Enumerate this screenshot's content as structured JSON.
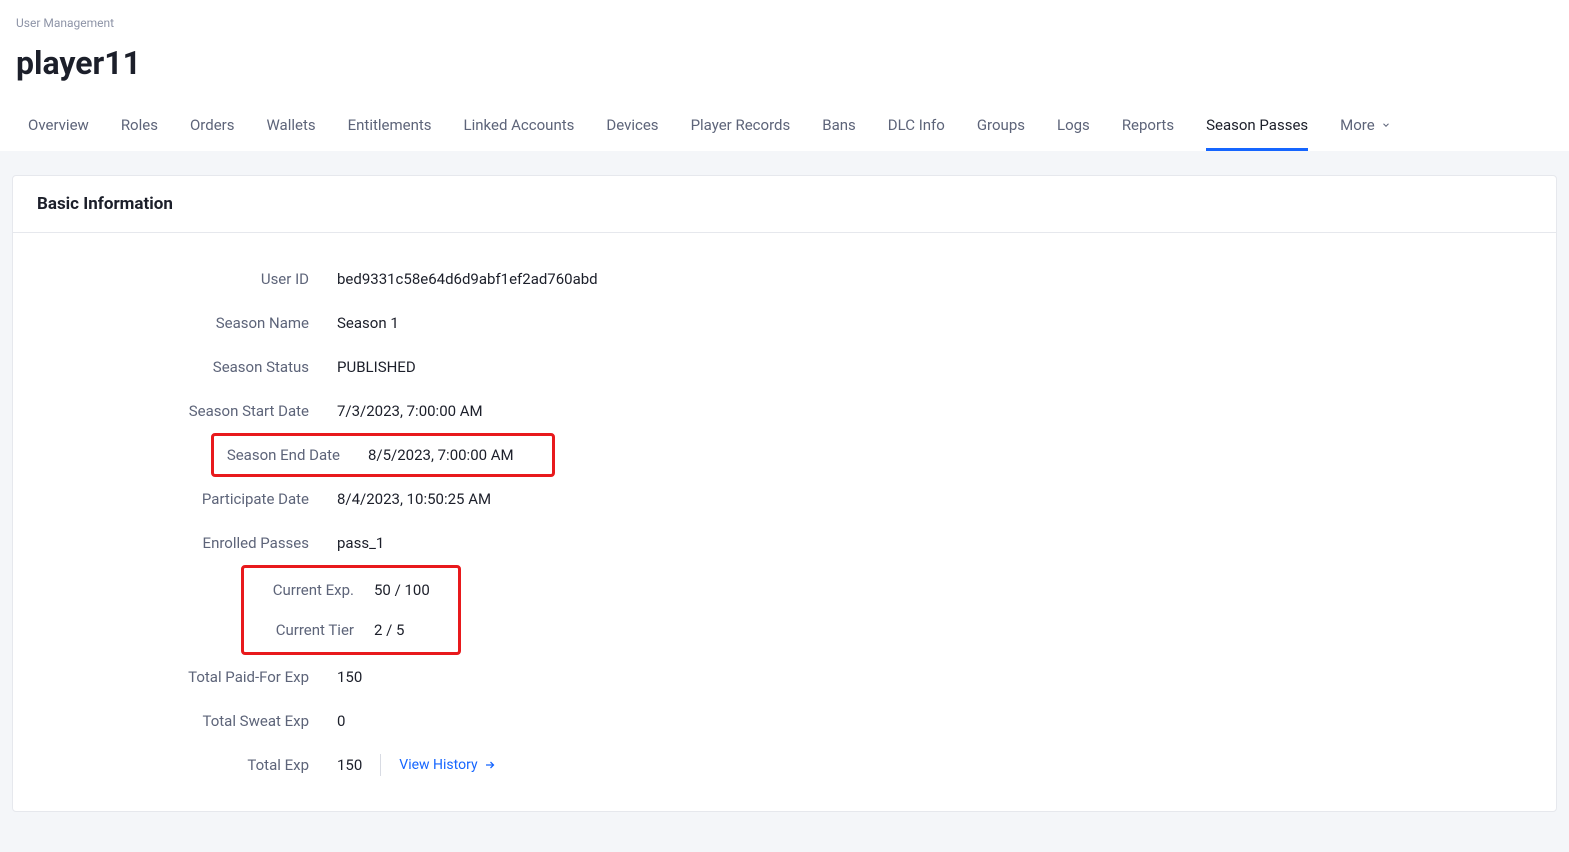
{
  "breadcrumb": "User Management",
  "page_title": "player11",
  "tabs": {
    "overview": "Overview",
    "roles": "Roles",
    "orders": "Orders",
    "wallets": "Wallets",
    "entitlements": "Entitlements",
    "linked_accounts": "Linked Accounts",
    "devices": "Devices",
    "player_records": "Player Records",
    "bans": "Bans",
    "dlc_info": "DLC Info",
    "groups": "Groups",
    "logs": "Logs",
    "reports": "Reports",
    "season_passes": "Season Passes",
    "more": "More"
  },
  "card": {
    "title": "Basic Information"
  },
  "fields": {
    "user_id": {
      "label": "User ID",
      "value": "bed9331c58e64d6d9abf1ef2ad760abd"
    },
    "season_name": {
      "label": "Season Name",
      "value": "Season 1"
    },
    "season_status": {
      "label": "Season Status",
      "value": "PUBLISHED"
    },
    "season_start": {
      "label": "Season Start Date",
      "value": "7/3/2023, 7:00:00 AM"
    },
    "season_end": {
      "label": "Season End Date",
      "value": "8/5/2023, 7:00:00 AM"
    },
    "participate_date": {
      "label": "Participate Date",
      "value": "8/4/2023, 10:50:25 AM"
    },
    "enrolled_passes": {
      "label": "Enrolled Passes",
      "value": "pass_1"
    },
    "current_exp": {
      "label": "Current Exp.",
      "value": "50 / 100"
    },
    "current_tier": {
      "label": "Current Tier",
      "value": "2 / 5"
    },
    "total_paidfor_exp": {
      "label": "Total Paid-For Exp",
      "value": "150"
    },
    "total_sweat_exp": {
      "label": "Total Sweat Exp",
      "value": "0"
    },
    "total_exp": {
      "label": "Total Exp",
      "value": "150"
    }
  },
  "actions": {
    "view_history": "View History"
  }
}
